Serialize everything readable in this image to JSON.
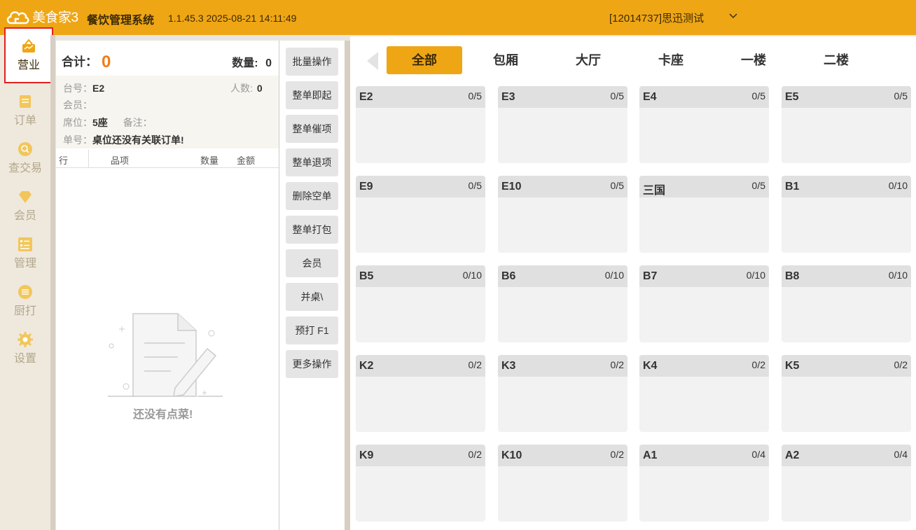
{
  "app": {
    "logo_text": "美食家3",
    "title": "餐饮管理系统",
    "version": "1.1.45.3 2025-08-21 14:11:49",
    "account": "[12014737]思迅测试",
    "accent_color": "#efa615"
  },
  "nav": [
    {
      "label": "营业",
      "icon": "business-icon",
      "active": true
    },
    {
      "label": "订单",
      "icon": "order-icon"
    },
    {
      "label": "查交易",
      "icon": "search-transaction-icon"
    },
    {
      "label": "会员",
      "icon": "member-icon"
    },
    {
      "label": "管理",
      "icon": "manage-icon"
    },
    {
      "label": "厨打",
      "icon": "kitchen-print-icon"
    },
    {
      "label": "设置",
      "icon": "settings-icon"
    }
  ],
  "order": {
    "sum_label": "合计：",
    "sum_value": "0",
    "qty_label": "数量:",
    "qty_value": "0",
    "table_label": "台号：",
    "table_value": "E2",
    "people_label": "人数:",
    "people_value": "0",
    "member_label": "会员：",
    "seat_label": "席位：",
    "seat_value": "5座",
    "remark_label": "备注：",
    "order_no_label": "单号：",
    "order_no_value": "桌位还没有关联订单!",
    "columns": [
      "行",
      "品项",
      "数量",
      "金额"
    ],
    "empty_text": "还没有点菜!"
  },
  "actions": [
    "批量操作",
    "整单即起",
    "整单催项",
    "整单退项",
    "删除空单",
    "整单打包",
    "会员",
    "并桌\\",
    "预打 F1",
    "更多操作"
  ],
  "tabs": [
    "全部",
    "包厢",
    "大厅",
    "卡座",
    "一楼",
    "二楼"
  ],
  "tables": [
    {
      "name": "E2",
      "cap": "0/5"
    },
    {
      "name": "E3",
      "cap": "0/5"
    },
    {
      "name": "E4",
      "cap": "0/5"
    },
    {
      "name": "E5",
      "cap": "0/5"
    },
    {
      "name": "E9",
      "cap": "0/5"
    },
    {
      "name": "E10",
      "cap": "0/5"
    },
    {
      "name": "三国",
      "cap": "0/5"
    },
    {
      "name": "B1",
      "cap": "0/10"
    },
    {
      "name": "B5",
      "cap": "0/10"
    },
    {
      "name": "B6",
      "cap": "0/10"
    },
    {
      "name": "B7",
      "cap": "0/10"
    },
    {
      "name": "B8",
      "cap": "0/10"
    },
    {
      "name": "K2",
      "cap": "0/2"
    },
    {
      "name": "K3",
      "cap": "0/2"
    },
    {
      "name": "K4",
      "cap": "0/2"
    },
    {
      "name": "K5",
      "cap": "0/2"
    },
    {
      "name": "K9",
      "cap": "0/2"
    },
    {
      "name": "K10",
      "cap": "0/2"
    },
    {
      "name": "A1",
      "cap": "0/4"
    },
    {
      "name": "A2",
      "cap": "0/4"
    }
  ]
}
